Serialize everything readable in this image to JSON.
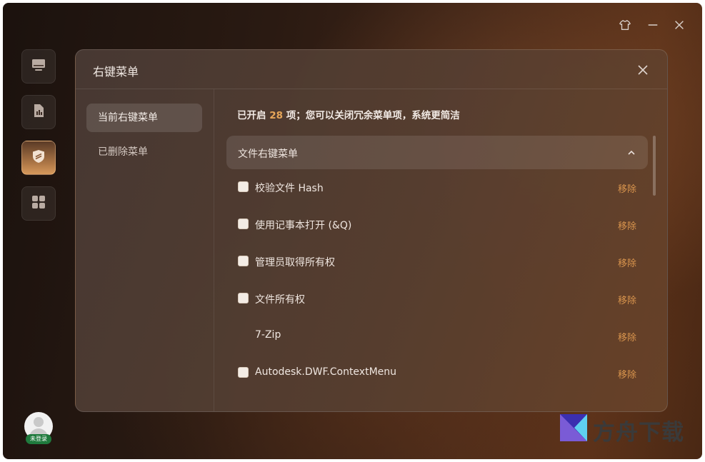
{
  "window": {
    "controls": [
      "skin-icon",
      "minimize-icon",
      "close-icon"
    ]
  },
  "rail": {
    "items": [
      {
        "icon": "monitor-icon"
      },
      {
        "icon": "report-icon"
      },
      {
        "icon": "shield-icon",
        "active": true
      },
      {
        "icon": "apps-grid-icon"
      }
    ]
  },
  "user": {
    "login_badge": "未登录"
  },
  "dialog": {
    "title": "右键菜单",
    "sidebar": [
      {
        "label": "当前右键菜单",
        "active": true
      },
      {
        "label": "已删除菜单",
        "active": false
      }
    ],
    "summary": {
      "prefix": "已开启 ",
      "count": "28",
      "suffix": " 项；您可以关闭冗余菜单项，系统更简洁"
    },
    "section": {
      "title": "文件右键菜单"
    },
    "rows": [
      {
        "label": "校验文件 Hash",
        "action": "移除",
        "checkbox": true
      },
      {
        "label": "使用记事本打开 (&Q)",
        "action": "移除",
        "checkbox": true
      },
      {
        "label": "管理员取得所有权",
        "action": "移除",
        "checkbox": true
      },
      {
        "label": "文件所有权",
        "action": "移除",
        "checkbox": true
      },
      {
        "label": "7-Zip",
        "action": "移除",
        "checkbox": false
      },
      {
        "label": "Autodesk.DWF.ContextMenu",
        "action": "移除",
        "checkbox": true
      }
    ]
  },
  "watermark": {
    "text": "方舟下载"
  },
  "colors": {
    "accent": "#e7a659",
    "action": "#d8944d",
    "badge": "#1f7a3d"
  }
}
